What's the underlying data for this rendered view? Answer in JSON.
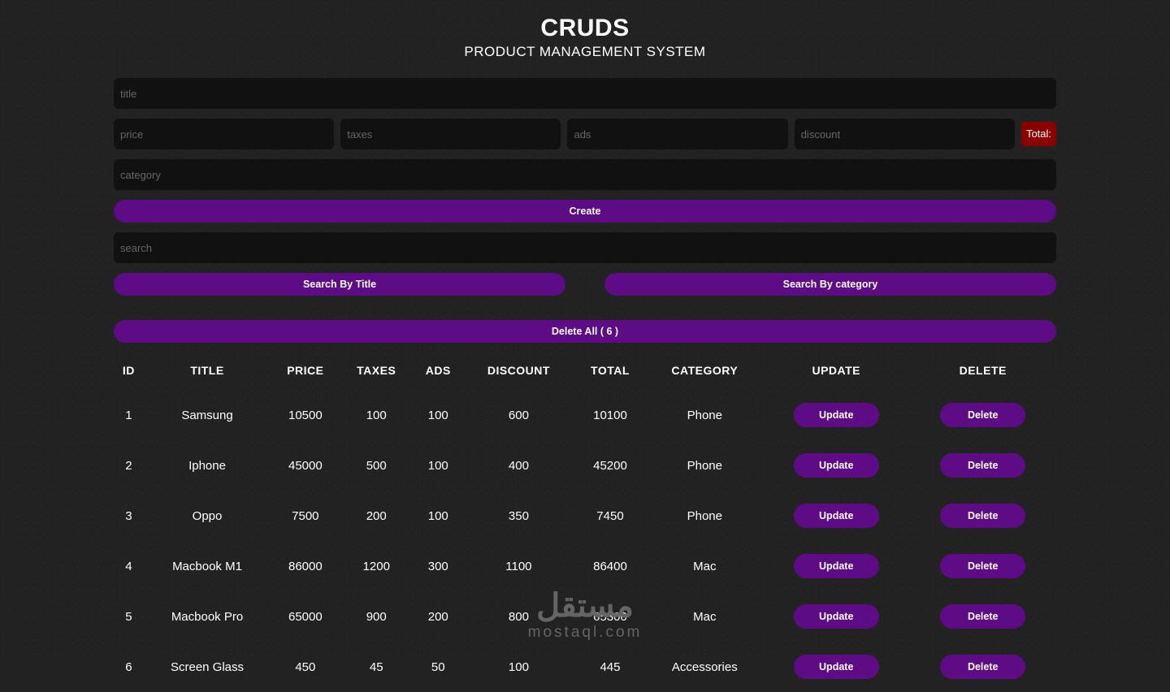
{
  "header": {
    "title": "CRUDS",
    "subtitle": "PRODUCT MANAGEMENT SYSTEM"
  },
  "inputs": {
    "title_ph": "title",
    "price_ph": "price",
    "taxes_ph": "taxes",
    "ads_ph": "ads",
    "discount_ph": "discount",
    "category_ph": "category",
    "search_ph": "search"
  },
  "labels": {
    "total_chip": "Total:",
    "create": "Create",
    "search_title": "Search By Title",
    "search_category": "Search By category",
    "delete_all": "Delete All ( 6 )",
    "update": "Update",
    "delete": "Delete"
  },
  "table": {
    "headers": [
      "ID",
      "TITLE",
      "PRICE",
      "TAXES",
      "ADS",
      "DISCOUNT",
      "TOTAL",
      "CATEGORY",
      "UPDATE",
      "DELETE"
    ],
    "rows": [
      {
        "id": "1",
        "title": "Samsung",
        "price": "10500",
        "taxes": "100",
        "ads": "100",
        "discount": "600",
        "total": "10100",
        "category": "Phone"
      },
      {
        "id": "2",
        "title": "Iphone",
        "price": "45000",
        "taxes": "500",
        "ads": "100",
        "discount": "400",
        "total": "45200",
        "category": "Phone"
      },
      {
        "id": "3",
        "title": "Oppo",
        "price": "7500",
        "taxes": "200",
        "ads": "100",
        "discount": "350",
        "total": "7450",
        "category": "Phone"
      },
      {
        "id": "4",
        "title": "Macbook M1",
        "price": "86000",
        "taxes": "1200",
        "ads": "300",
        "discount": "1100",
        "total": "86400",
        "category": "Mac"
      },
      {
        "id": "5",
        "title": "Macbook Pro",
        "price": "65000",
        "taxes": "900",
        "ads": "200",
        "discount": "800",
        "total": "65300",
        "category": "Mac"
      },
      {
        "id": "6",
        "title": "Screen Glass",
        "price": "450",
        "taxes": "45",
        "ads": "50",
        "discount": "100",
        "total": "445",
        "category": "Accessories"
      }
    ]
  },
  "watermark": {
    "ar": "مستقل",
    "en": "mostaql.com"
  }
}
